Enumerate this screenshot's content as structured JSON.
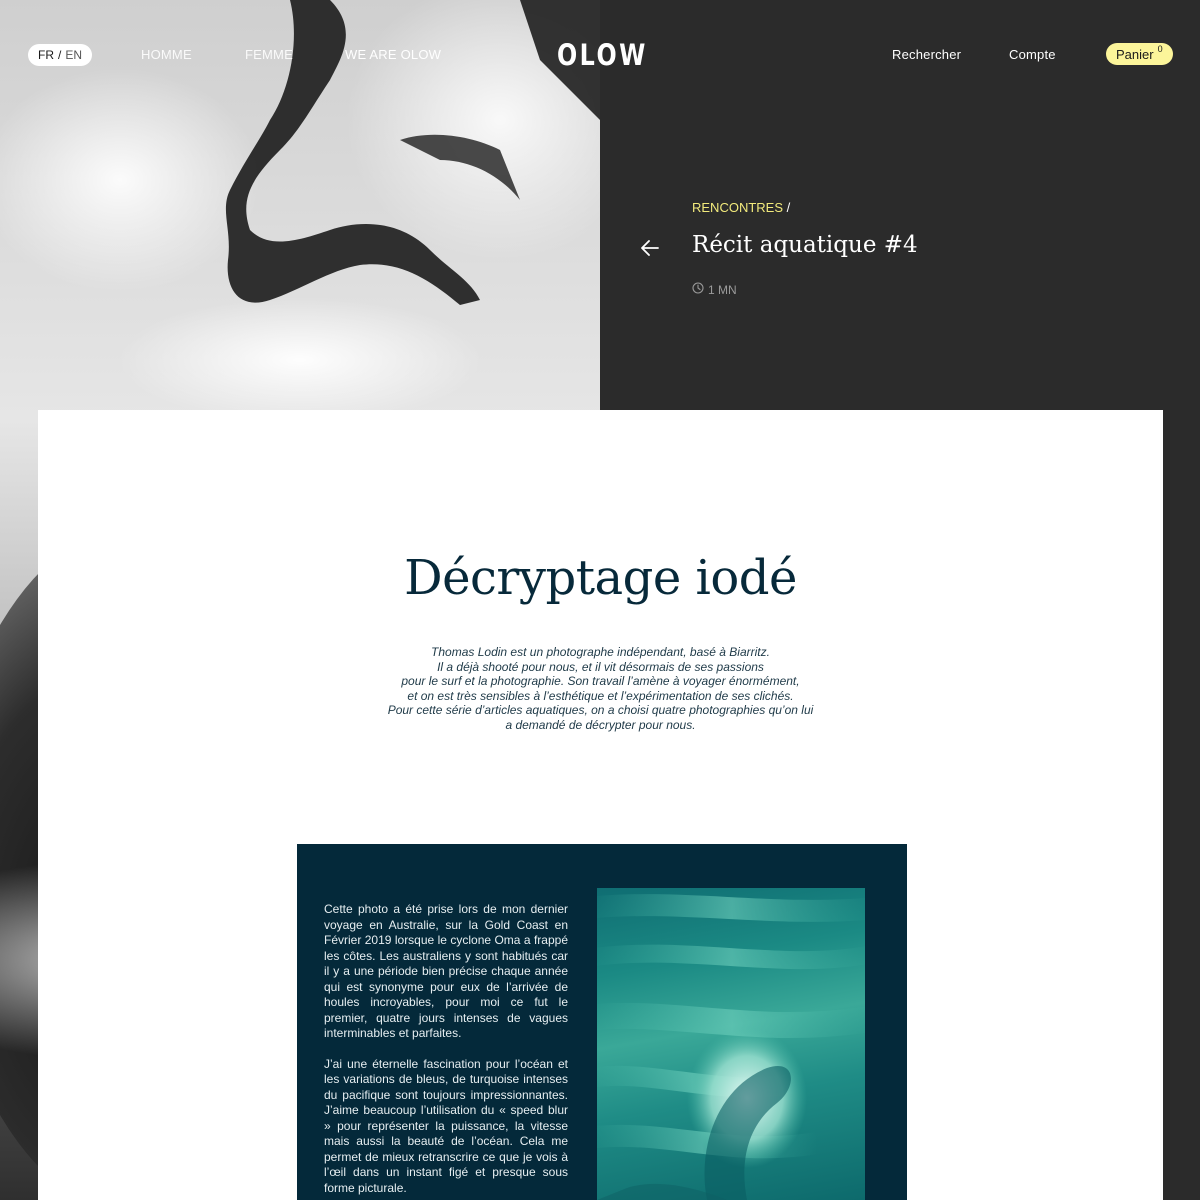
{
  "header": {
    "lang_active": "FR",
    "lang_separator": "/",
    "lang_inactive": "EN",
    "nav_homme": "HOMME",
    "nav_femme": "FEMME",
    "nav_we_are": "WE ARE OLOW",
    "logo": "OLOW",
    "search": "Rechercher",
    "account": "Compte",
    "cart_label": "Panier",
    "cart_count": "0"
  },
  "article": {
    "breadcrumb_category": "RENCONTRES",
    "breadcrumb_separator": "/",
    "title": "Récit aquatique #4",
    "read_time": "1 MN",
    "back_icon": "arrow-left-icon",
    "clock_icon": "clock-icon"
  },
  "section": {
    "title": "Décryptage iodé",
    "intro_lines": [
      "Thomas Lodin est un photographe indépendant, basé à Biarritz.",
      "Il a déjà shooté pour nous, et il vit désormais de ses passions",
      "pour le surf et la photographie. Son travail l’amène à voyager énormément,",
      "et on est très sensibles à l’esthétique et l’expérimentation de ses clichés.",
      "Pour cette série d’articles aquatiques, on a choisi quatre photographies qu’on lui",
      "a demandé de décrypter pour nous."
    ]
  },
  "story": {
    "paragraph_1": "Cette photo a été prise lors de mon dernier voyage en Australie, sur la Gold Coast en Février 2019 lorsque le cyclone Oma a frappé les côtes. Les australiens y sont habitués car il y a une période bien précise chaque année qui est synonyme pour eux de l’arrivée de houles incroyables, pour moi ce fut le premier, quatre jours intenses de vagues interminables et parfaites.",
    "paragraph_2": "J’ai une éternelle fascination pour l’océan et les variations de bleus, de turquoise intenses du pacifique sont toujours impressionnantes. J’aime beaucoup l’utilisation du « speed blur » pour représenter la puissance, la vitesse mais aussi la beauté de l’océan. Cela me permet de mieux retranscrire ce que je vois à l’œil dans un instant figé et presque sous forme picturale."
  },
  "colors": {
    "dark_bg": "#2b2b2b",
    "accent_yellow": "#f2ea7c",
    "cart_yellow": "#fcf59a",
    "navy": "#04293a",
    "title_navy": "#07293a"
  }
}
